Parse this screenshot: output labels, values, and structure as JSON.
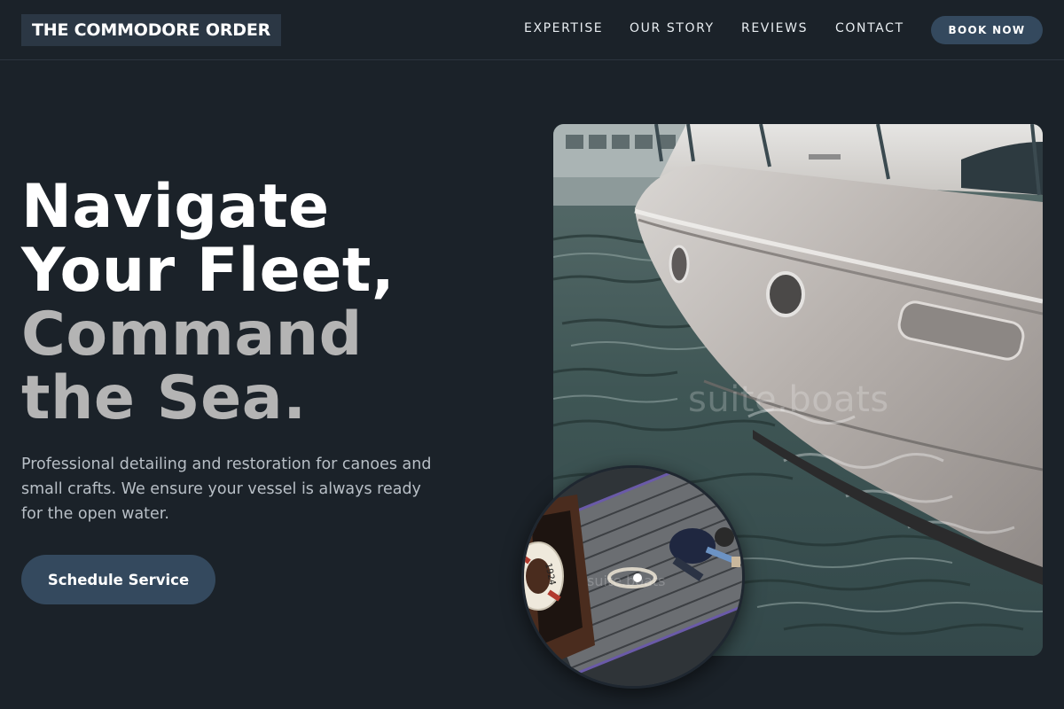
{
  "nav": {
    "logo": "THE COMMODORE ORDER",
    "links": [
      "EXPERTISE",
      "OUR STORY",
      "REVIEWS",
      "CONTACT"
    ],
    "book_label": "BOOK NOW"
  },
  "hero": {
    "headline_lines": [
      "Navigate",
      "Your Fleet,",
      "Command",
      "the Sea."
    ],
    "subtext": "Professional detailing and restoration for canoes and small crafts. We ensure your vessel is always ready for the open water.",
    "cta_label": "Schedule Service"
  },
  "media": {
    "main_watermark": "suite.boats",
    "inset_watermark": "suite.boats",
    "lifebuoy_text": "1924"
  },
  "colors": {
    "background": "#1b2229",
    "button": "#34495e",
    "logo_bg": "#2b3744",
    "headline_white": "#ffffff",
    "headline_grey": "#b4b4b4"
  }
}
